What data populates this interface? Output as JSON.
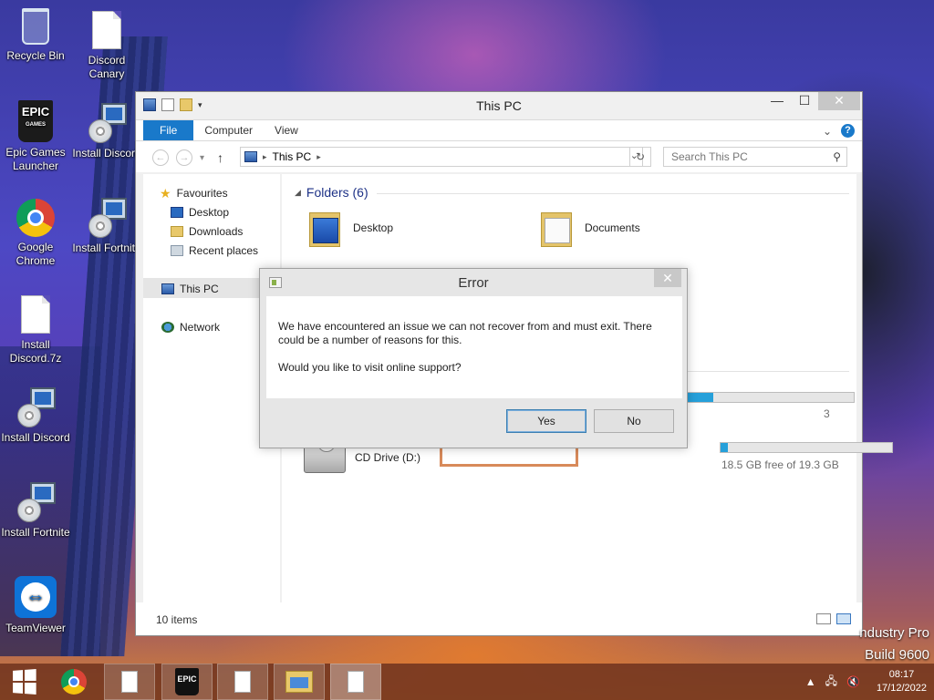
{
  "desktop": {
    "icons": [
      {
        "label": "Recycle Bin"
      },
      {
        "label": "Discord Canary"
      },
      {
        "label": "Epic Games Launcher"
      },
      {
        "label": "Install Discord"
      },
      {
        "label": "Google Chrome"
      },
      {
        "label": "Install Fortnite"
      },
      {
        "label": "Install Discord.7z"
      },
      {
        "label": "Install Discord"
      },
      {
        "label": "Install Fortnite"
      },
      {
        "label": "TeamViewer"
      }
    ],
    "watermark": {
      "line1": "ndustry Pro",
      "line2": "Build 9600"
    }
  },
  "explorer": {
    "title": "This PC",
    "ribbon_tabs": [
      "File",
      "Computer",
      "View"
    ],
    "address": "This PC",
    "search_placeholder": "Search This PC",
    "nav": {
      "favourites": "Favourites",
      "desktop": "Desktop",
      "downloads": "Downloads",
      "recent": "Recent places",
      "this_pc": "This PC",
      "network": "Network"
    },
    "folders_header": "Folders (6)",
    "folders": [
      "Desktop",
      "Documents"
    ],
    "drives": [
      {
        "label": "CD Drive (D:)",
        "free_text": ""
      },
      {
        "label": "",
        "free_text": "18.5 GB free of 19.3 GB",
        "used_fraction": 0.04
      }
    ],
    "partial_drive_text": "3",
    "upper_drive_fill": 0.18,
    "status": "10 items"
  },
  "dialog": {
    "title": "Error",
    "message": "We have encountered an issue we can not recover from and must exit. There could be a number of reasons for this.",
    "question": "Would you like to visit online support?",
    "yes_label": "Yes",
    "no_label": "No"
  },
  "taskbar": {
    "time": "08:17",
    "date": "17/12/2022"
  },
  "colors": {
    "accent": "#1979ca",
    "progress": "#26a0da"
  }
}
